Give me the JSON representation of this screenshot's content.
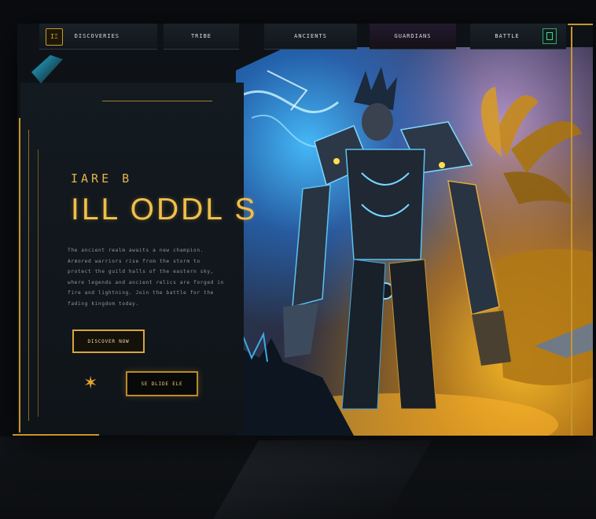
{
  "nav": {
    "logo": "IΞ",
    "tabs": [
      "DISCOVERIES",
      "TRIBE",
      "ANCIENTS",
      "GUARDIANS",
      "BATTLE"
    ]
  },
  "hero": {
    "eyebrow": "IARE B",
    "headline": "ILL ODDL S",
    "body": "The ancient realm awaits a new champion. Armored warriors rise from the storm to protect the guild halls of the eastern sky, where legends and ancient relics are forged in fire and lightning. Join the battle for the fading kingdom today.",
    "primary_button": "DISCOVER NOW",
    "secondary_button": "SE DLIDE ELE"
  },
  "colors": {
    "accent_gold": "#f0bf4a",
    "accent_blue": "#4ec3ff",
    "panel": "#131a20",
    "background": "#0a0c0f"
  },
  "icons": {
    "logo": "guild-emblem-icon",
    "nav_end": "menu-box-icon",
    "star": "star-sparkle-icon"
  }
}
